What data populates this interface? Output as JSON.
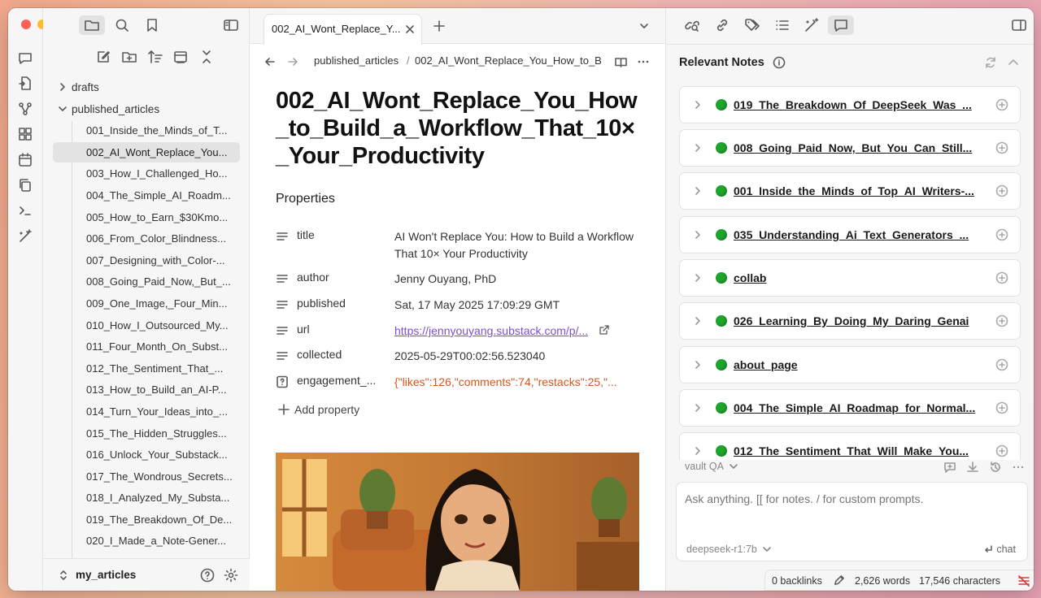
{
  "ribbon": {
    "icons": [
      "chat-icon",
      "file-import-icon",
      "graph-icon",
      "grid-icon",
      "calendar-icon",
      "copy-icon",
      "terminal-icon",
      "magic-wand-icon"
    ]
  },
  "sidebar": {
    "folders": {
      "drafts": "drafts",
      "published": "published_articles"
    },
    "files": [
      "001_Inside_the_Minds_of_T...",
      "002_AI_Wont_Replace_You...",
      "003_How_I_Challenged_Ho...",
      "004_The_Simple_AI_Roadm...",
      "005_How_to_Earn_$30Kmo...",
      "006_From_Color_Blindness...",
      "007_Designing_with_Color-...",
      "008_Going_Paid_Now,_But_...",
      "009_One_Image,_Four_Min...",
      "010_How_I_Outsourced_My...",
      "011_Four_Month_On_Subst...",
      "012_The_Sentiment_That_...",
      "013_How_to_Build_an_AI-P...",
      "014_Turn_Your_Ideas_into_...",
      "015_The_Hidden_Struggles...",
      "016_Unlock_Your_Substack...",
      "017_The_Wondrous_Secrets...",
      "018_I_Analyzed_My_Substa...",
      "019_The_Breakdown_Of_De...",
      "020_I_Made_a_Note-Gener..."
    ],
    "active_index": 1,
    "vault_name": "my_articles"
  },
  "tab": {
    "label": "002_AI_Wont_Replace_Y..."
  },
  "breadcrumb": {
    "folder": "published_articles",
    "separator": "/",
    "file": "002_AI_Wont_Replace_You_How_to_B"
  },
  "document": {
    "title": "002_AI_Wont_Replace_You_How_to_Build_a_Workflow_That_10×_Your_Productivity",
    "properties_heading": "Properties",
    "properties": [
      {
        "key": "title",
        "value": "AI Won't Replace You: How to Build a Workflow That 10× Your Productivity"
      },
      {
        "key": "author",
        "value": "Jenny Ouyang, PhD"
      },
      {
        "key": "published",
        "value": "Sat, 17 May 2025 17:09:29 GMT"
      },
      {
        "key": "url",
        "value": "https://jennyouyang.substack.com/p/..."
      },
      {
        "key": "collected",
        "value": "2025-05-29T00:02:56.523040"
      },
      {
        "key": "engagement_...",
        "value": "{\"likes\":126,\"comments\":74,\"restacks\":25,\"..."
      }
    ],
    "add_property": "Add property"
  },
  "relevant_notes": {
    "heading": "Relevant Notes",
    "items": [
      "019_The_Breakdown_Of_DeepSeek_Was_...",
      "008_Going_Paid_Now,_But_You_Can_Still...",
      "001_Inside_the_Minds_of_Top_AI_Writers-...",
      "035_Understanding_Ai_Text_Generators_...",
      "collab",
      "026_Learning_By_Doing_My_Daring_Genai",
      "about_page",
      "004_The_Simple_AI_Roadmap_for_Normal...",
      "012_The_Sentiment_That_Will_Make_You..."
    ]
  },
  "chat": {
    "mode": "vault QA",
    "placeholder": "Ask anything. [[ for notes. / for custom prompts.",
    "model": "deepseek-r1:7b",
    "send_label": "chat"
  },
  "status": {
    "backlinks": "0 backlinks",
    "words": "2,626 words",
    "characters": "17,546 characters"
  },
  "colors": {
    "accent_link": "#7a4fd0",
    "json_orange": "#d9541d",
    "green_dot": "#1fa52d",
    "status_red": "#d93a3a"
  }
}
